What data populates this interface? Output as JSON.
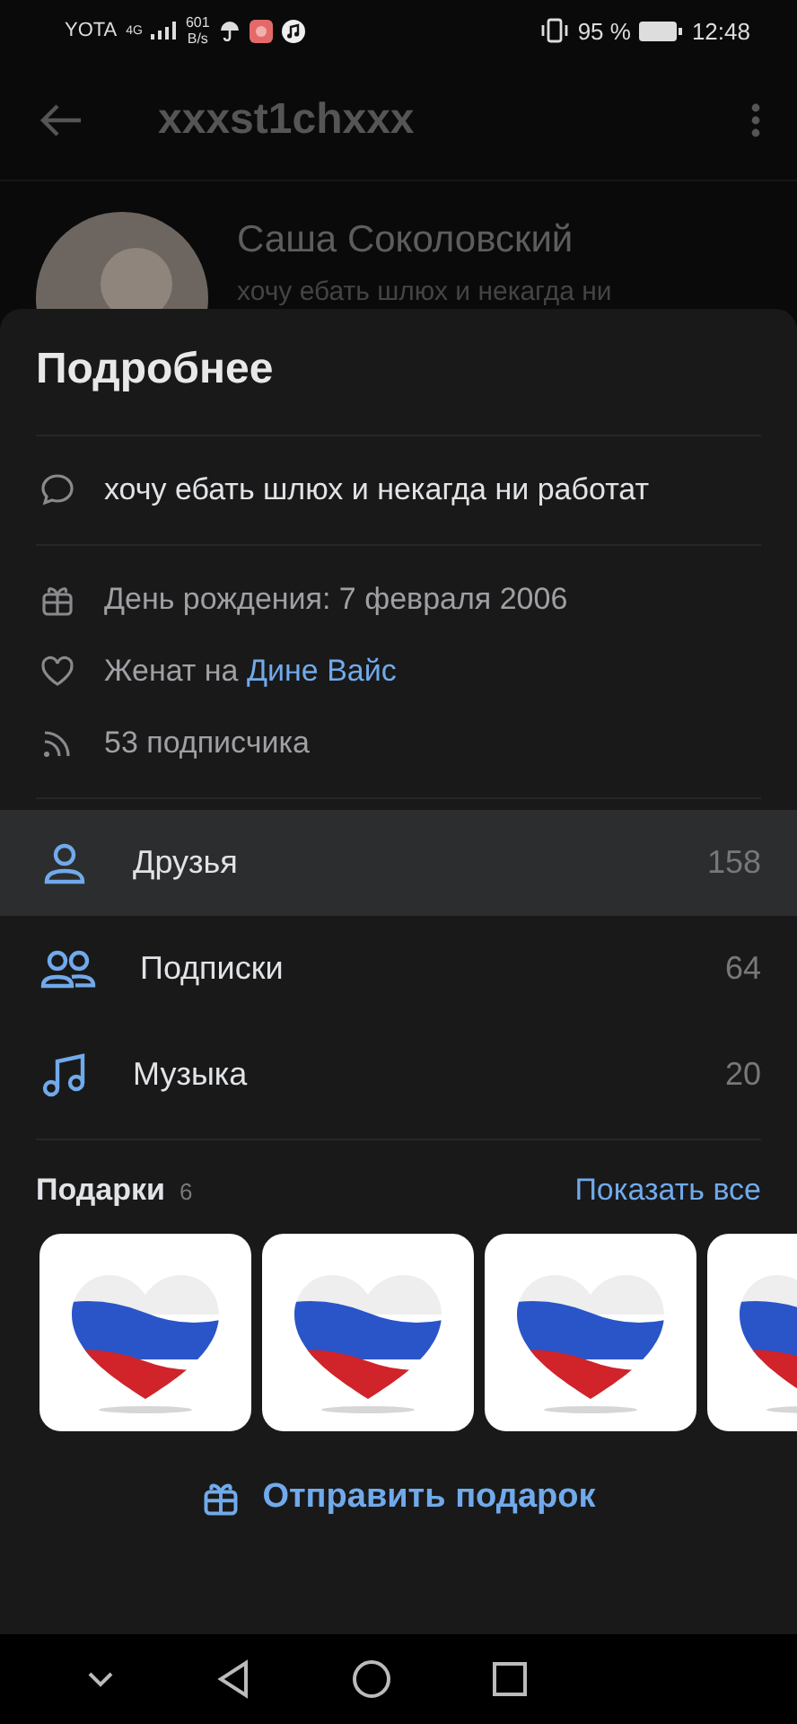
{
  "status_bar": {
    "carrier": "YOTA",
    "network": "4G",
    "speed": "601",
    "speed_unit": "B/s",
    "battery": "95 %",
    "time": "12:48"
  },
  "app_bar": {
    "title": "xxxst1chxxx"
  },
  "profile": {
    "name": "Саша Соколовский",
    "status": "хочу ебать шлюх и некагда ни"
  },
  "sheet": {
    "title": "Подробнее",
    "status": "хочу ебать шлюх и некагда ни работат",
    "details": [
      {
        "kind": "birthday",
        "text": "День рождения: 7 февраля 2006"
      },
      {
        "kind": "relationship",
        "text": "Женат на ",
        "link": "Дине Вайс"
      },
      {
        "kind": "followers",
        "text": "53 подписчика"
      }
    ],
    "menu": [
      {
        "kind": "friends",
        "label": "Друзья",
        "count": "158",
        "selected": true
      },
      {
        "kind": "subscriptions",
        "label": "Подписки",
        "count": "64",
        "selected": false
      },
      {
        "kind": "music",
        "label": "Музыка",
        "count": "20",
        "selected": false
      }
    ],
    "gifts": {
      "title": "Подарки",
      "count": "6",
      "show_all": "Показать все",
      "send_button": "Отправить подарок"
    }
  }
}
